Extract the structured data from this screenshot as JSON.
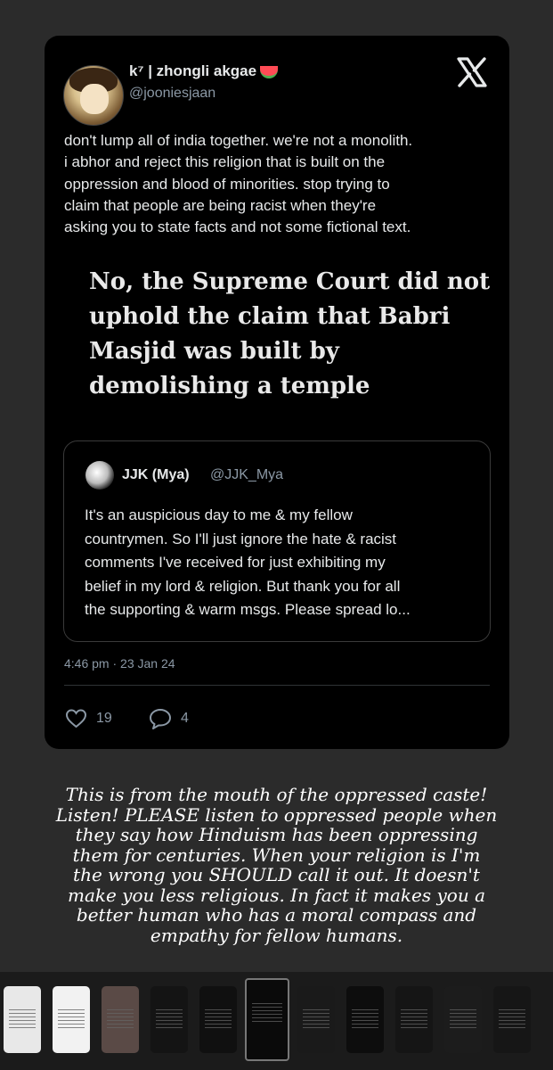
{
  "post": {
    "display_name": "k⁷ | zhongli akgae",
    "handle": "@jooniesjaan",
    "text_lines": [
      "don't lump all of india together. we're not a monolith.",
      "i abhor and reject this religion that is built on the",
      "oppression and blood of minorities. stop trying to",
      "claim that people are being racist when they're",
      "asking you to state facts and not some fictional text."
    ],
    "headline_lines": [
      "No, the Supreme Court did not",
      "uphold the claim that Babri",
      "Masjid was built by",
      "demolishing a temple"
    ],
    "quote": {
      "name": "JJK (Mya)",
      "handle": "@JJK_Mya",
      "text_lines": [
        "It's an auspicious day to me & my fellow",
        "countrymen. So I'll just ignore the hate & racist",
        "comments I've received for just exhibiting my",
        "belief in my lord & religion. But thank you for all",
        "the supporting & warm msgs. Please spread lo..."
      ]
    },
    "timestamp": "4:46 pm · 23 Jan 24",
    "likes": "19",
    "replies": "4",
    "icons": {
      "like": "heart-icon",
      "reply": "speech-bubble-icon",
      "brand": "x-logo-icon"
    }
  },
  "caption_lines": [
    "This is from the mouth of the oppressed caste!",
    "Listen! PLEASE listen to oppressed people when",
    "they say how Hinduism has been oppressing",
    "them for centuries. When your religion is I'm",
    "the wrong you SHOULD call it out. It doesn't",
    "make you less religious. In fact it makes you a",
    "better human who has a moral compass and",
    "empathy for fellow humans."
  ],
  "thumbnails": {
    "count": 11,
    "active_index": 5,
    "colors": [
      "#e8e8e8",
      "#f2f2f2",
      "#5a4a46",
      "#141414",
      "#101010",
      "#0a0a0a",
      "#1a1a1a",
      "#0d0d0d",
      "#151515",
      "#1c1c1c",
      "#161616"
    ]
  },
  "colors": {
    "background": "#2b2b2b",
    "card": "#000000",
    "text": "#e7e9ea",
    "secondary": "#8b98a5"
  }
}
